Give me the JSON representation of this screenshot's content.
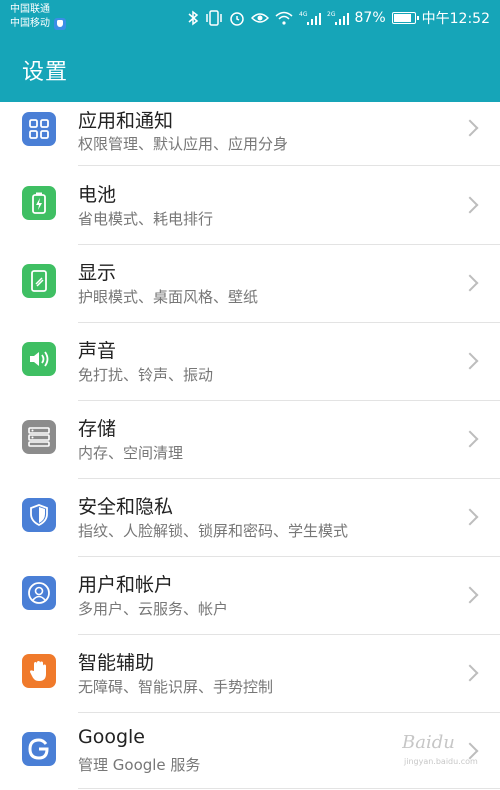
{
  "status_bar": {
    "carrier_1": "中国联通",
    "carrier_2": "中国移动",
    "battery_level": "87%",
    "battery_fraction": 0.87,
    "time": "中午12:52"
  },
  "appbar": {
    "title": "设置"
  },
  "items": [
    {
      "title": "应用和通知",
      "subtitle": "权限管理、默认应用、应用分身",
      "icon": "apps-grid-icon",
      "color": "#4a7fd6"
    },
    {
      "title": "电池",
      "subtitle": "省电模式、耗电排行",
      "icon": "battery-icon",
      "color": "#3fbf63"
    },
    {
      "title": "显示",
      "subtitle": "护眼模式、桌面风格、壁纸",
      "icon": "display-icon",
      "color": "#3fbf63"
    },
    {
      "title": "声音",
      "subtitle": "免打扰、铃声、振动",
      "icon": "speaker-icon",
      "color": "#3fbf63"
    },
    {
      "title": "存储",
      "subtitle": "内存、空间清理",
      "icon": "storage-icon",
      "color": "#8c8c8c"
    },
    {
      "title": "安全和隐私",
      "subtitle": "指纹、人脸解锁、锁屏和密码、学生模式",
      "icon": "shield-icon",
      "color": "#4a7fd6"
    },
    {
      "title": "用户和帐户",
      "subtitle": "多用户、云服务、帐户",
      "icon": "user-icon",
      "color": "#4a7fd6"
    },
    {
      "title": "智能辅助",
      "subtitle": "无障碍、智能识屏、手势控制",
      "icon": "hand-icon",
      "color": "#f07a2b"
    },
    {
      "title": "Google",
      "subtitle": "管理 Google 服务",
      "icon": "google-icon",
      "color": "#4a7fd6"
    }
  ],
  "watermark": {
    "brand": "Baidu",
    "sub": "jingyan.baidu.com"
  }
}
